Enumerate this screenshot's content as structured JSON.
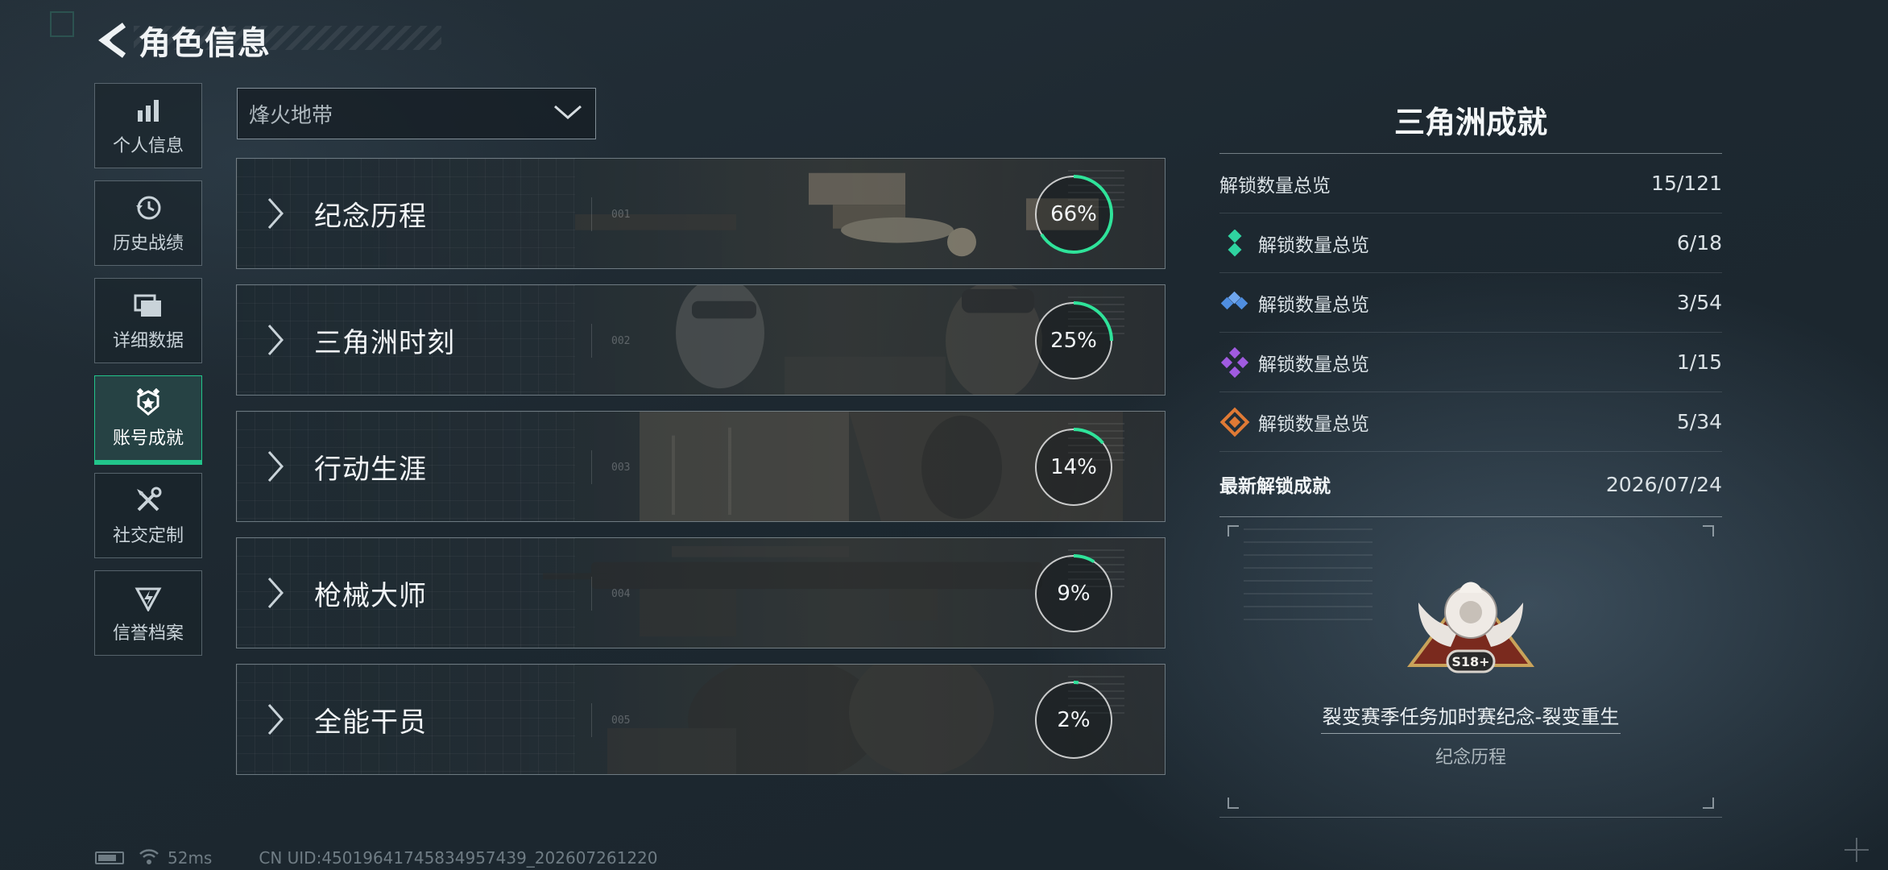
{
  "header": {
    "title": "角色信息"
  },
  "nav": {
    "items": [
      {
        "label": "个人信息",
        "icon": "bar-chart-icon",
        "active": false
      },
      {
        "label": "历史战绩",
        "icon": "history-clock-icon",
        "active": false
      },
      {
        "label": "详细数据",
        "icon": "folder-icon",
        "active": false
      },
      {
        "label": "账号成就",
        "icon": "achievement-badge-icon",
        "active": true
      },
      {
        "label": "社交定制",
        "icon": "tools-icon",
        "active": false
      },
      {
        "label": "信誉档案",
        "icon": "credit-shield-icon",
        "active": false
      }
    ]
  },
  "mode_select": {
    "value": "烽火地带"
  },
  "categories": [
    {
      "label": "纪念历程",
      "percent_text": "66%",
      "progress": 0.66,
      "index": "001"
    },
    {
      "label": "三角洲时刻",
      "percent_text": "25%",
      "progress": 0.25,
      "index": "002"
    },
    {
      "label": "行动生涯",
      "percent_text": "14%",
      "progress": 0.14,
      "index": "003"
    },
    {
      "label": "枪械大师",
      "percent_text": "9%",
      "progress": 0.09,
      "index": "004"
    },
    {
      "label": "全能干员",
      "percent_text": "2%",
      "progress": 0.02,
      "index": "005"
    }
  ],
  "summary": {
    "title": "三角洲成就",
    "total": {
      "label": "解锁数量总览",
      "value": "15/121"
    },
    "tiers": [
      {
        "label": "解锁数量总览",
        "value": "6/18",
        "color": "#2fd3a0",
        "icon": "green-tier-icon"
      },
      {
        "label": "解锁数量总览",
        "value": "3/54",
        "color": "#4f8ee0",
        "icon": "blue-tier-icon"
      },
      {
        "label": "解锁数量总览",
        "value": "1/15",
        "color": "#a05be0",
        "icon": "purple-tier-icon"
      },
      {
        "label": "解锁数量总览",
        "value": "5/34",
        "color": "#e07a35",
        "icon": "orange-tier-icon"
      }
    ],
    "latest": {
      "label": "最新解锁成就",
      "date": "2026/07/24",
      "badge_text": "S18+",
      "name": "裂变赛季任务加时赛纪念-裂变重生",
      "category": "纪念历程"
    }
  },
  "status_bar": {
    "ping": "52ms",
    "uid": "CN UID:4501964174583495743​9_202607261220"
  },
  "colors": {
    "accent": "#22c58b",
    "ring": "#2fe39a"
  }
}
